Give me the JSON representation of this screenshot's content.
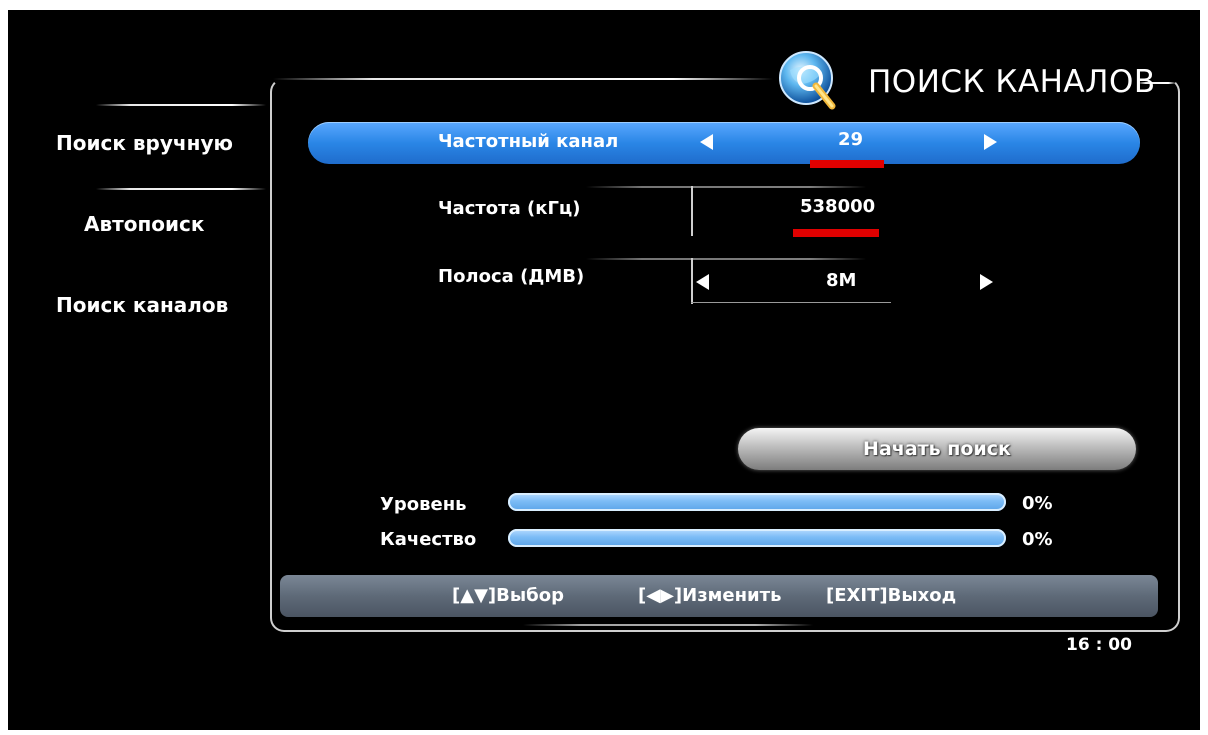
{
  "header": {
    "title": "ПОИСК КАНАЛОВ"
  },
  "sidebar": {
    "items": [
      {
        "label": "Поиск вручную",
        "active": true
      },
      {
        "label": "Автопоиск",
        "active": false
      },
      {
        "label": "Поиск каналов",
        "active": false
      }
    ]
  },
  "form": {
    "channel": {
      "label": "Частотный канал",
      "value": "29"
    },
    "frequency": {
      "label": "Частота (кГц)",
      "value": "538000"
    },
    "bandwidth": {
      "label": "Полоса (ДМВ)",
      "value": "8M"
    }
  },
  "start_button": {
    "label": "Начать поиск"
  },
  "signal": {
    "level": {
      "label": "Уровень",
      "value_text": "0%",
      "fraction": 0
    },
    "quality": {
      "label": "Качество",
      "value_text": "0%",
      "fraction": 0
    }
  },
  "help_bar": {
    "select": "[▲▼]Выбор",
    "change": "[◀▶]Изменить",
    "exit": "[EXIT]Выход"
  },
  "clock": "16 : 00",
  "colors": {
    "highlight": "#2a86e6",
    "underline": "#e00000",
    "bar": "#7cbcf6",
    "help_bar": "#5e6a78"
  },
  "icons": [
    "globe-search-icon",
    "arrow-left-icon",
    "arrow-right-icon"
  ]
}
